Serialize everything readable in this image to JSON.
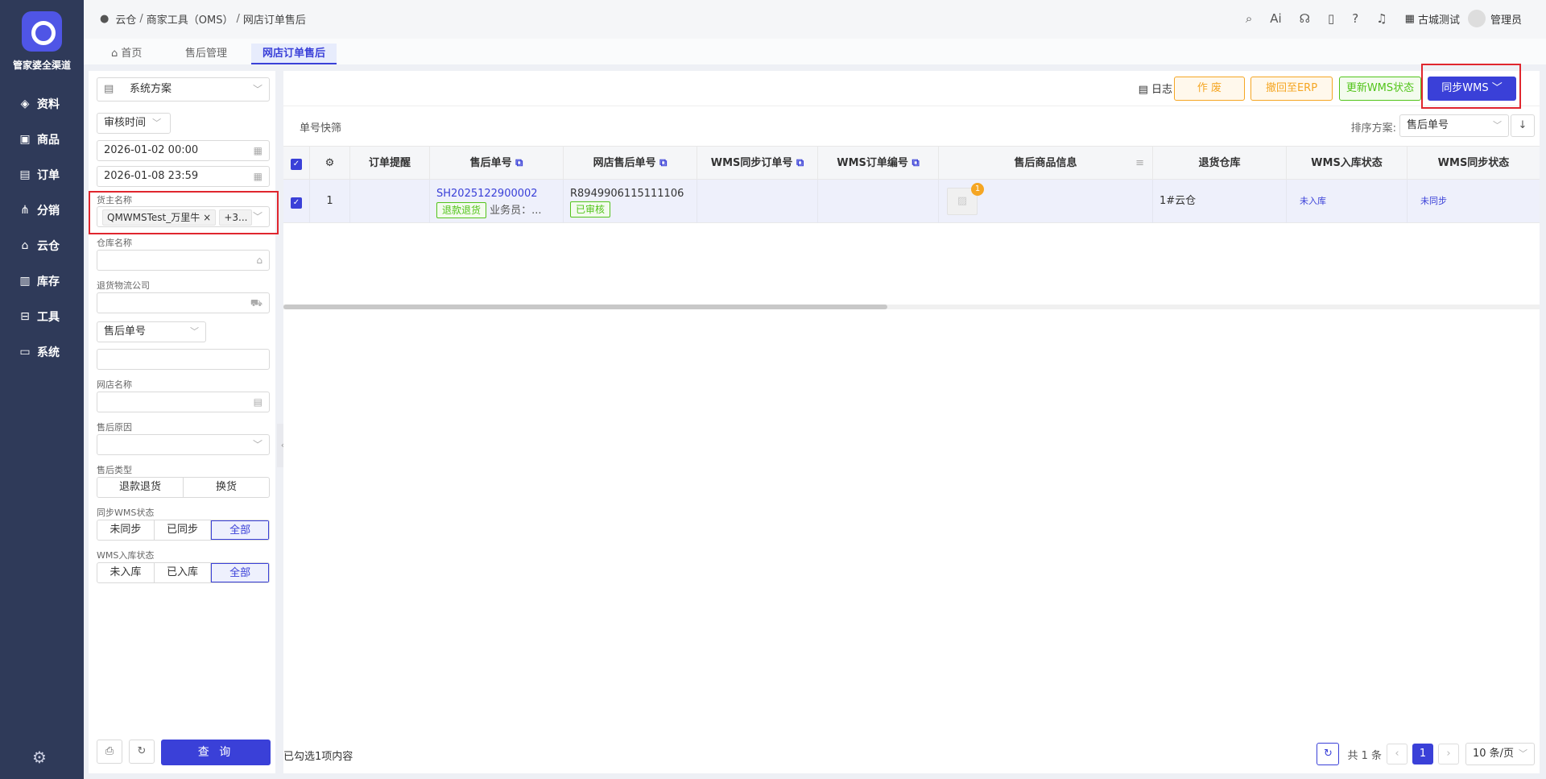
{
  "nav": {
    "brand": "管家婆全渠道",
    "items": [
      {
        "label": "资料",
        "icon": "layers-icon"
      },
      {
        "label": "商品",
        "icon": "product-icon"
      },
      {
        "label": "订单",
        "icon": "order-icon"
      },
      {
        "label": "分销",
        "icon": "distribution-icon"
      },
      {
        "label": "云仓",
        "icon": "cloud-warehouse-icon"
      },
      {
        "label": "库存",
        "icon": "inventory-icon"
      },
      {
        "label": "工具",
        "icon": "toolbox-icon"
      },
      {
        "label": "系统",
        "icon": "monitor-icon"
      }
    ]
  },
  "header": {
    "breadcrumb": [
      "云仓",
      "商家工具（OMS）",
      "网店订单售后"
    ],
    "company": "古城测试",
    "user": "管理员"
  },
  "tabs": [
    {
      "label": "首页"
    },
    {
      "label": "售后管理"
    },
    {
      "label": "网店订单售后"
    }
  ],
  "filters": {
    "scheme": "系统方案",
    "time_type": "审核时间",
    "start_time": "2026-01-02 00:00",
    "end_time": "2026-01-08 23:59",
    "owner_label": "货主名称",
    "owner_tag": "QMWMSTest_万里牛",
    "owner_more": "+3...",
    "warehouse_label": "仓库名称",
    "logistics_label": "退货物流公司",
    "doc_type": "售后单号",
    "shop_label": "网店名称",
    "reason_label": "售后原因",
    "after_type_label": "售后类型",
    "after_types": [
      "退款退货",
      "换货"
    ],
    "sync_label": "同步WMS状态",
    "sync_options": [
      "未同步",
      "已同步",
      "全部"
    ],
    "instock_label": "WMS入库状态",
    "instock_options": [
      "未入库",
      "已入库",
      "全部"
    ],
    "query": "查 询"
  },
  "toolbar": {
    "log": "日志",
    "void": "作 废",
    "revoke": "撤回至ERP",
    "update_wms": "更新WMS状态",
    "sync_wms": "同步WMS"
  },
  "quick_filter": "单号快筛",
  "sort": {
    "label": "排序方案:",
    "value": "售后单号"
  },
  "table": {
    "columns": [
      "订单提醒",
      "售后单号",
      "网店售后单号",
      "WMS同步订单号",
      "WMS订单编号",
      "售后商品信息",
      "退货仓库",
      "WMS入库状态",
      "WMS同步状态"
    ],
    "rows": [
      {
        "index": "1",
        "after_no": "SH2025122900002",
        "after_type_tag": "退款退货",
        "salesman": "业务员：...",
        "shop_after_no": "R8949906115111106",
        "audit_tag": "已审核",
        "goods_badge": "1",
        "warehouse": "1#云仓",
        "instock_status": "未入库",
        "sync_status": "未同步"
      }
    ]
  },
  "footer": {
    "selected": "已勾选1项内容",
    "total": "共 1 条",
    "page": "1",
    "page_size": "10 条/页"
  },
  "colors": {
    "primary": "#3a40d8",
    "nav_bg": "#2f3a59",
    "warning": "#f5a623",
    "success": "#52c41a",
    "highlight": "#e0262e"
  }
}
